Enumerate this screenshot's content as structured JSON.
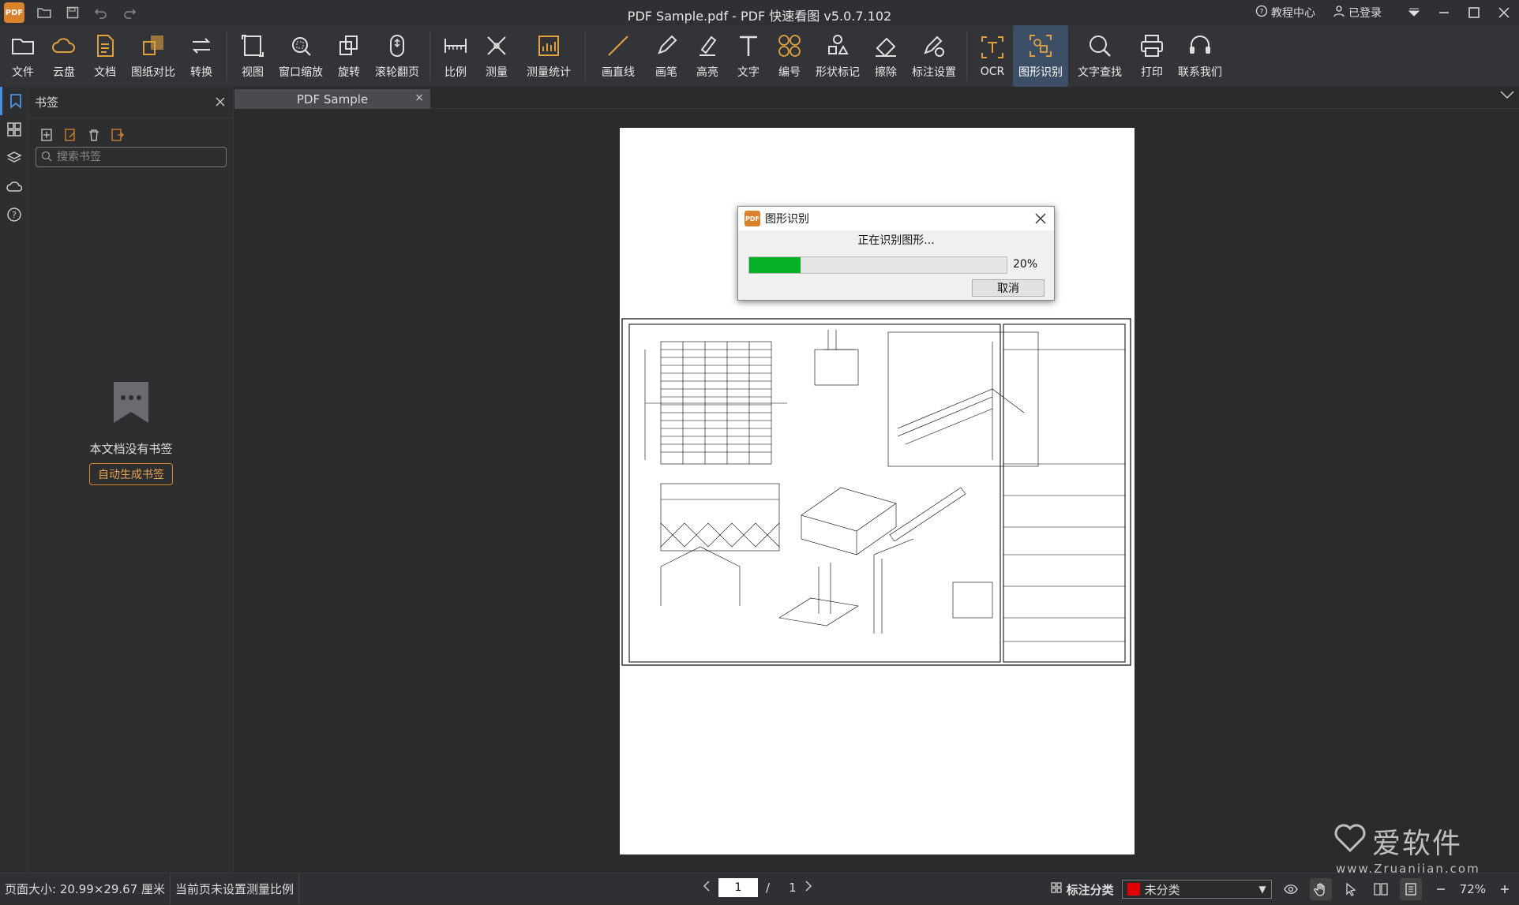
{
  "titlebar": {
    "title": "PDF Sample.pdf - PDF 快速看图 v5.0.7.102",
    "tutorial": "教程中心",
    "login": "已登录"
  },
  "toolbar": {
    "items": [
      {
        "label": "文件",
        "icon": "folder-icon"
      },
      {
        "label": "云盘",
        "icon": "cloud-icon"
      },
      {
        "label": "文档",
        "icon": "document-icon"
      },
      {
        "label": "图纸对比",
        "icon": "compare-icon"
      },
      {
        "label": "转换",
        "icon": "convert-icon"
      },
      {
        "label": "视图",
        "icon": "view-icon"
      },
      {
        "label": "窗口缩放",
        "icon": "zoom-window-icon"
      },
      {
        "label": "旋转",
        "icon": "rotate-icon"
      },
      {
        "label": "滚轮翻页",
        "icon": "mouse-wheel-icon"
      },
      {
        "label": "比例",
        "icon": "scale-ruler-icon"
      },
      {
        "label": "测量",
        "icon": "measure-icon"
      },
      {
        "label": "测量统计",
        "icon": "measure-stats-icon"
      },
      {
        "label": "画直线",
        "icon": "line-icon"
      },
      {
        "label": "画笔",
        "icon": "pen-icon"
      },
      {
        "label": "高亮",
        "icon": "highlight-icon"
      },
      {
        "label": "文字",
        "icon": "text-icon"
      },
      {
        "label": "编号",
        "icon": "numbering-icon"
      },
      {
        "label": "形状标记",
        "icon": "shape-mark-icon"
      },
      {
        "label": "擦除",
        "icon": "eraser-icon"
      },
      {
        "label": "标注设置",
        "icon": "annotation-settings-icon"
      },
      {
        "label": "OCR",
        "icon": "ocr-icon"
      },
      {
        "label": "图形识别",
        "icon": "shape-recognition-icon"
      },
      {
        "label": "文字查找",
        "icon": "text-search-icon"
      },
      {
        "label": "打印",
        "icon": "printer-icon"
      },
      {
        "label": "联系我们",
        "icon": "headset-icon"
      }
    ]
  },
  "panel": {
    "title": "书签",
    "search_placeholder": "搜索书签",
    "empty_message": "本文档没有书签",
    "auto_generate": "自动生成书签"
  },
  "tab": {
    "label": "PDF Sample"
  },
  "dialog": {
    "title": "图形识别",
    "message": "正在识别图形...",
    "progress": 0.2,
    "progress_text": "20%",
    "cancel": "取消"
  },
  "watermark": {
    "brand": "爱软件",
    "url": "www.Zruanjian.com"
  },
  "status": {
    "page_size": "页面大小: 20.99×29.67 厘米",
    "scale_msg": "当前页未设置测量比例",
    "current_page": "1",
    "separator": "/",
    "total_pages": "1",
    "mark_category": "标注分类",
    "category_value": "未分类",
    "category_color": "#e00000",
    "zoom": "72%"
  }
}
